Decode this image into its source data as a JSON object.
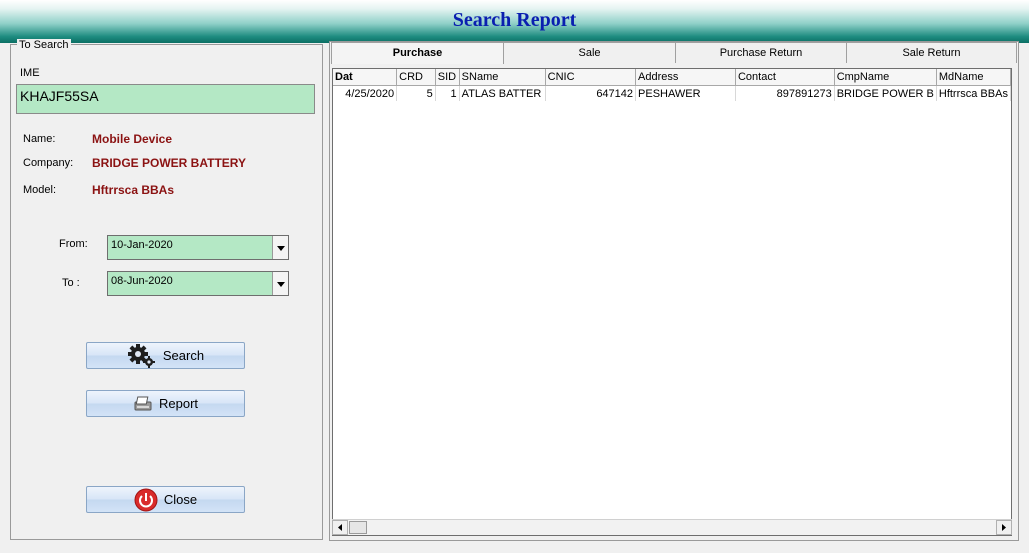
{
  "window": {
    "title": "Search Report"
  },
  "left_panel": {
    "group_label": "To Search",
    "ime_label": "IME",
    "ime_value": "KHAJF55SA",
    "info": [
      {
        "label": "Name:",
        "value": "Mobile Device"
      },
      {
        "label": "Company:",
        "value": "BRIDGE POWER BATTERY"
      },
      {
        "label": "Model:",
        "value": "Hftrrsca BBAs"
      }
    ],
    "from_label": "From:",
    "from_value": "10-Jan-2020",
    "to_label": "To :",
    "to_value": "08-Jun-2020",
    "search_label": "Search",
    "report_label": "Report",
    "close_label": "Close"
  },
  "tabs": [
    "Purchase",
    "Sale",
    "Purchase Return",
    "Sale Return"
  ],
  "grid": {
    "columns": [
      "Dat",
      "CRD",
      "SID",
      "SName",
      "CNIC",
      "Address",
      "Contact",
      "CmpName",
      "MdName"
    ],
    "rows": [
      [
        "4/25/2020",
        "5",
        "1",
        "ATLAS BATTER",
        "647142",
        "PESHAWER",
        "897891273",
        "BRIDGE POWER B",
        "Hftrrsca BBAs"
      ]
    ]
  }
}
